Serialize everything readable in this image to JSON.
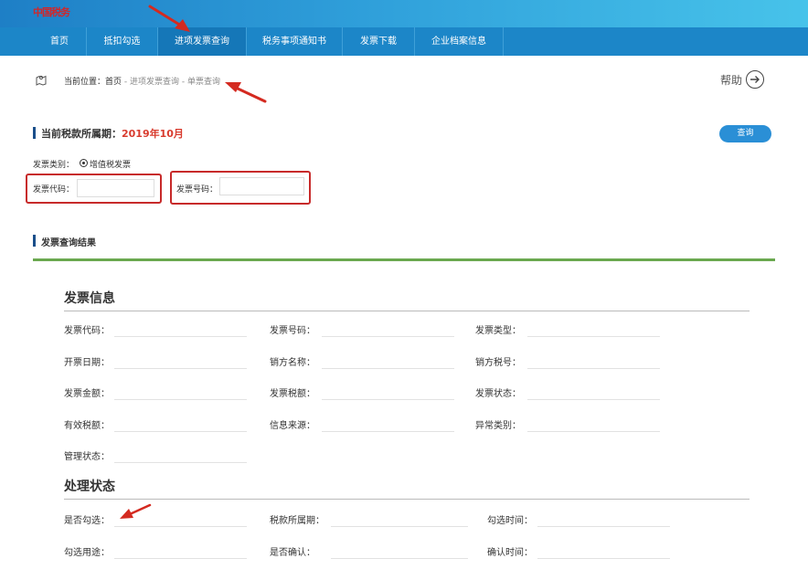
{
  "logo": {
    "text": "中国税务"
  },
  "nav": {
    "items": [
      "首页",
      "抵扣勾选",
      "进项发票查询",
      "税务事项通知书",
      "发票下载",
      "企业档案信息"
    ]
  },
  "breadcrumb": {
    "prefix": "当前位置：",
    "home": "首页",
    "sep1": " - ",
    "level1": "进项发票查询",
    "sep2": " - ",
    "level2": "单票查询"
  },
  "help": {
    "label": "帮助"
  },
  "period": {
    "label": "当前税款所属期：",
    "value": "2019年10月"
  },
  "query_button": "查询",
  "filter": {
    "type_label": "发票类别：",
    "type_option": "增值税发票",
    "code_label": "发票代码：",
    "number_label": "发票号码："
  },
  "results": {
    "title": "发票查询结果"
  },
  "invoice_info": {
    "title": "发票信息",
    "fields": [
      "发票代码：",
      "发票号码：",
      "发票类型：",
      "开票日期：",
      "销方名称：",
      "销方税号：",
      "发票金额：",
      "发票税额：",
      "发票状态：",
      "有效税额：",
      "信息来源：",
      "异常类别：",
      "管理状态："
    ]
  },
  "processing": {
    "title": "处理状态",
    "fields": [
      "是否勾选：",
      "税款所属期：",
      "勾选时间：",
      "勾选用途：",
      "是否确认：",
      "确认时间："
    ]
  },
  "colors": {
    "accent": "#1c86c8",
    "period": "#d83b2e",
    "annotation": "#c72a2a",
    "divider": "#6aa84f"
  }
}
